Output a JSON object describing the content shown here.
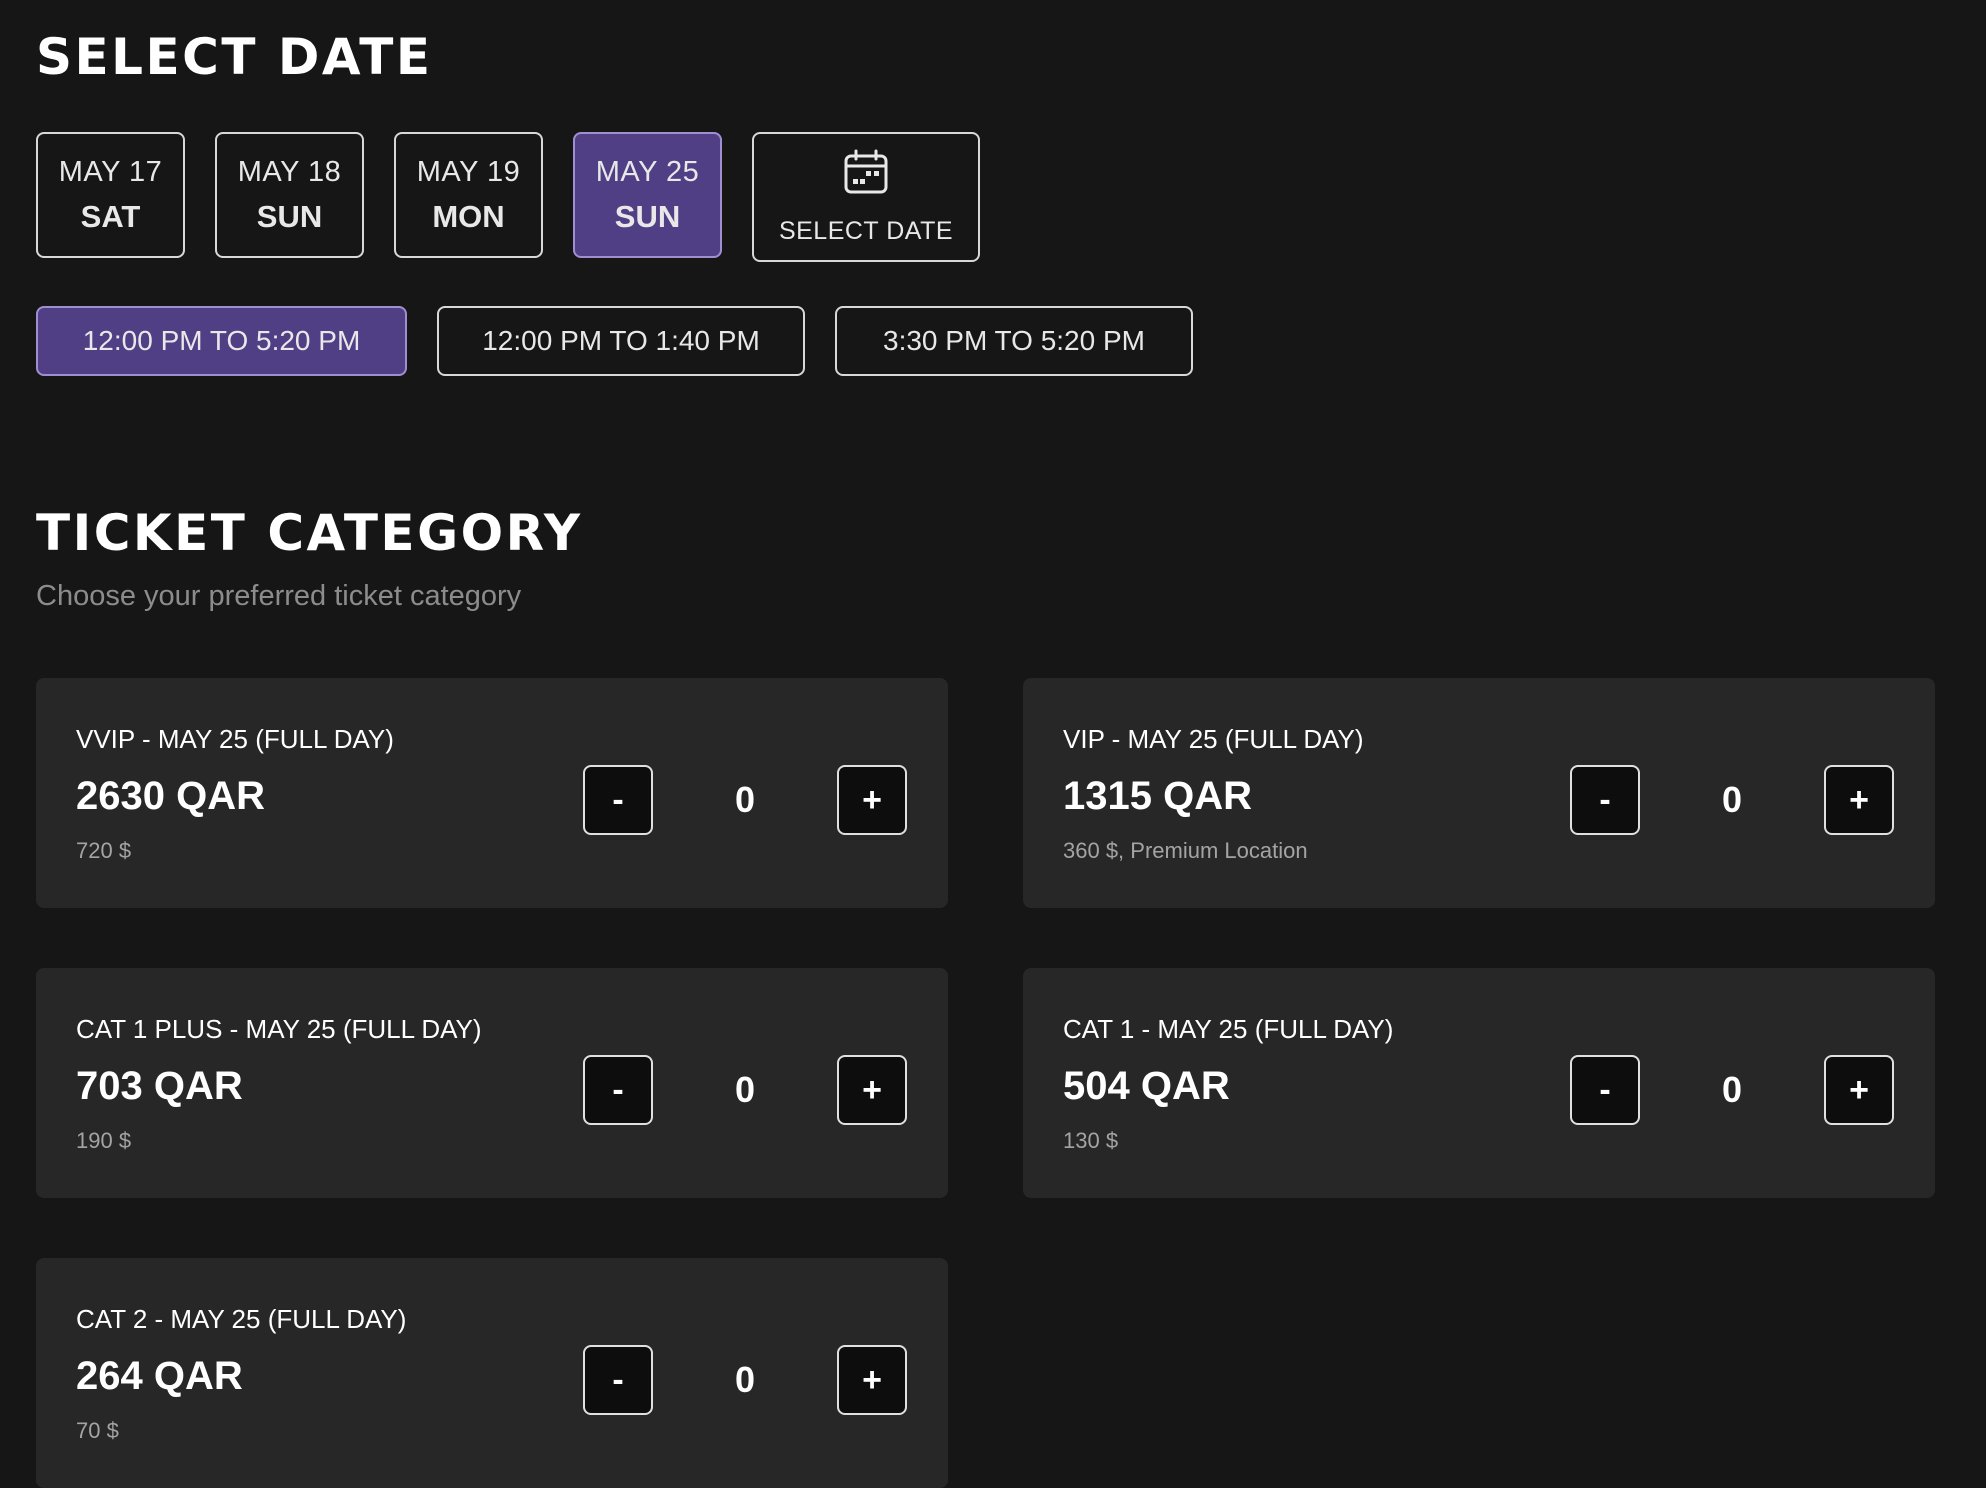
{
  "date_section": {
    "title": "SELECT DATE",
    "dates": [
      {
        "date": "MAY 17",
        "day": "SAT",
        "selected": false
      },
      {
        "date": "MAY 18",
        "day": "SUN",
        "selected": false
      },
      {
        "date": "MAY 19",
        "day": "MON",
        "selected": false
      },
      {
        "date": "MAY 25",
        "day": "SUN",
        "selected": true
      }
    ],
    "calendar_button": {
      "label": "SELECT DATE",
      "icon": "calendar-icon"
    },
    "times": [
      {
        "label": "12:00 PM TO 5:20 PM",
        "selected": true
      },
      {
        "label": "12:00 PM TO 1:40 PM",
        "selected": false
      },
      {
        "label": "3:30 PM TO 5:20 PM",
        "selected": false
      }
    ]
  },
  "ticket_section": {
    "title": "TICKET CATEGORY",
    "subtitle": "Choose your preferred ticket category",
    "minus_label": "-",
    "plus_label": "+",
    "categories": [
      {
        "name": "VVIP - MAY 25 (FULL DAY)",
        "price": "2630 QAR",
        "note": "720 $",
        "quantity": "0"
      },
      {
        "name": "VIP - MAY 25 (FULL DAY)",
        "price": "1315 QAR",
        "note": "360 $, Premium Location",
        "quantity": "0"
      },
      {
        "name": "CAT 1 PLUS - MAY 25 (FULL DAY)",
        "price": "703 QAR",
        "note": "190 $",
        "quantity": "0"
      },
      {
        "name": "CAT 1 - MAY 25 (FULL DAY)",
        "price": "504 QAR",
        "note": "130 $",
        "quantity": "0"
      },
      {
        "name": "CAT 2 - MAY 25 (FULL DAY)",
        "price": "264 QAR",
        "note": "70 $",
        "quantity": "0"
      }
    ]
  },
  "colors": {
    "background": "#161617",
    "card": "#272727",
    "accent": "#513f86",
    "accent_border": "#a08fd0",
    "muted_text": "#8c8c8c"
  }
}
